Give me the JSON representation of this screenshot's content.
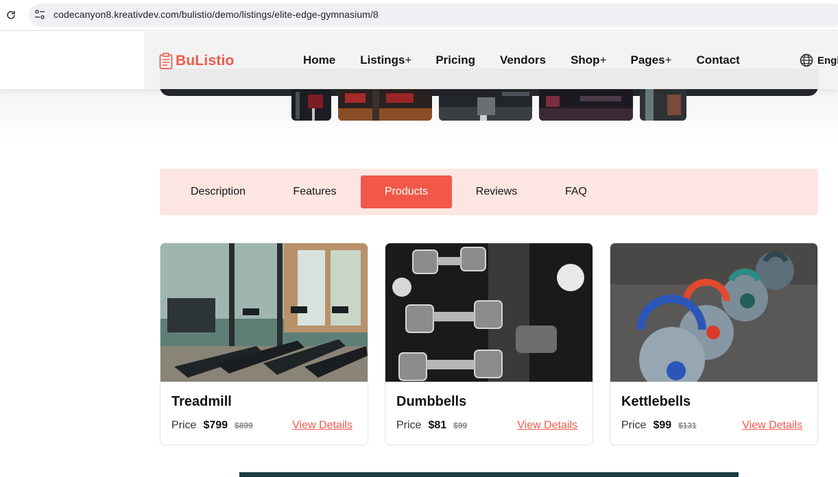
{
  "browser": {
    "url": "codecanyon8.kreativdev.com/bulistio/demo/listings/elite-edge-gymnasium/8"
  },
  "header": {
    "logo_text": "BuListio",
    "nav": [
      {
        "label": "Home",
        "has_plus": false
      },
      {
        "label": "Listings",
        "has_plus": true
      },
      {
        "label": "Pricing",
        "has_plus": false
      },
      {
        "label": "Vendors",
        "has_plus": false
      },
      {
        "label": "Shop",
        "has_plus": true
      },
      {
        "label": "Pages",
        "has_plus": true
      },
      {
        "label": "Contact",
        "has_plus": false
      }
    ],
    "plus_symbol": "+",
    "language": "Engl"
  },
  "tabs": {
    "items": [
      "Description",
      "Features",
      "Products",
      "Reviews",
      "FAQ"
    ],
    "active": "Products"
  },
  "products": [
    {
      "name": "Treadmill",
      "price_label": "Price",
      "price": "$799",
      "old_price": "$899",
      "link": "View Details"
    },
    {
      "name": "Dumbbells",
      "price_label": "Price",
      "price": "$81",
      "old_price": "$99",
      "link": "View Details"
    },
    {
      "name": "Kettlebells",
      "price_label": "Price",
      "price": "$99",
      "old_price": "$131",
      "link": "View Details"
    }
  ],
  "colors": {
    "accent": "#f2584a",
    "tab_background": "#fde6e2",
    "link": "#f05a4a"
  },
  "icons": {
    "reload": "reload-icon",
    "site_info": "site-info-icon",
    "logo": "clipboard-logo-icon",
    "language": "globe-icon"
  }
}
